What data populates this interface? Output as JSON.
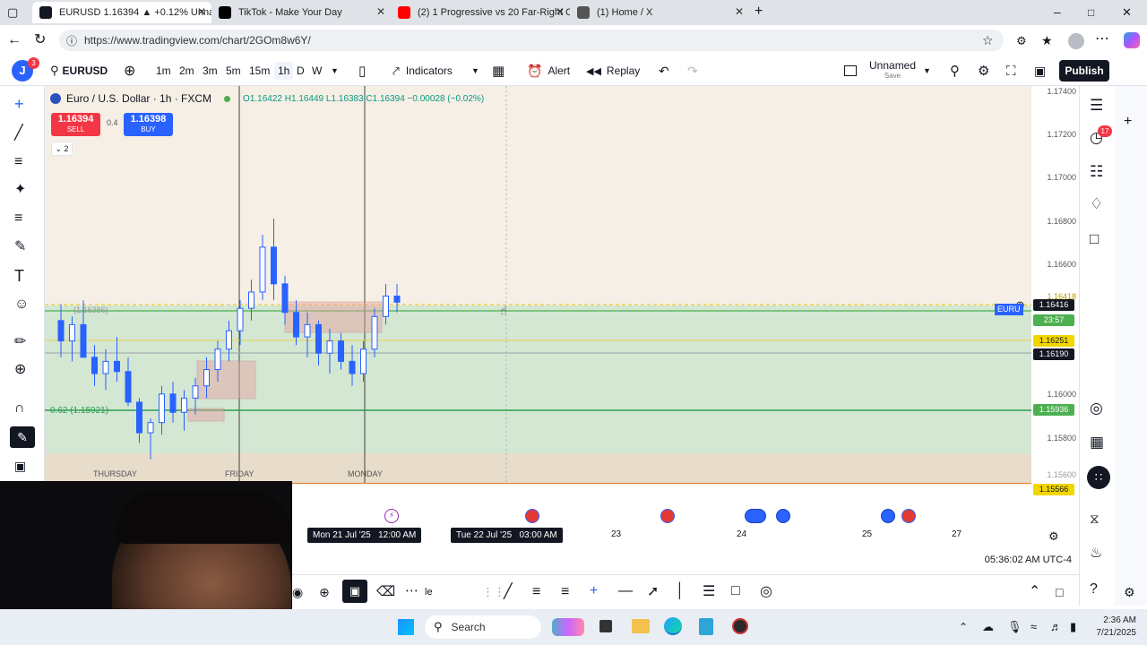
{
  "browser": {
    "tabs": [
      {
        "title": "EURUSD 1.16394 ▲ +0.12% Unna",
        "color": "#131722",
        "active": true
      },
      {
        "title": "TikTok - Make Your Day",
        "color": "#000000",
        "active": false
      },
      {
        "title": "(2) 1 Progressive vs 20 Far-Right C",
        "color": "#ff0000",
        "active": false
      },
      {
        "title": "(1) Home / X",
        "color": "#000000",
        "active": false
      }
    ],
    "url": "https://www.tradingview.com/chart/2GOm8w6Y/"
  },
  "header": {
    "avatar_letter": "J",
    "avatar_badge": "3",
    "symbol": "EURUSD",
    "intervals": [
      "1m",
      "2m",
      "3m",
      "5m",
      "15m",
      "1h",
      "D",
      "W"
    ],
    "active_interval": "1h",
    "indicators_label": "Indicators",
    "alert_label": "Alert",
    "replay_label": "Replay",
    "layout_name": "Unnamed",
    "layout_sub": "Save",
    "publish_label": "Publish"
  },
  "legend": {
    "title": "Euro / U.S. Dollar · 1h · FXCM",
    "ohlc": "O1.16422 H1.16449 L1.16383 C1.16394 −0.00028 (−0.02%)",
    "sell_price": "1.16394",
    "sell_label": "SELL",
    "spread": "0.4",
    "buy_price": "1.16398",
    "buy_label": "BUY",
    "collapse_count": "2"
  },
  "chart": {
    "fib_label_upper": "(1.16386)",
    "fib_label_lower": "0.62 (1.15921)",
    "day_labels": [
      "THURSDAY",
      "FRIDAY",
      "MONDAY"
    ],
    "symbol_tag": "EURU"
  },
  "price_axis": {
    "labels": [
      "1.17400",
      "1.17200",
      "1.17000",
      "1.16800",
      "1.16600",
      "1.16000",
      "1.15800",
      "1.15600"
    ],
    "badges": [
      {
        "text": "1.16416",
        "color": "#131722"
      },
      {
        "text": "23:57",
        "color": "#4caf50"
      },
      {
        "text": "1.16251",
        "color": "#f2d600"
      },
      {
        "text": "1.16190",
        "color": "#131722"
      },
      {
        "text": "1.15936",
        "color": "#4caf50"
      },
      {
        "text": "1.15566",
        "color": "#f2d600"
      }
    ],
    "partial": "1.16418"
  },
  "time_axis": {
    "cursor_left": "Mon 21 Jul '25",
    "cursor_left_time": "12:00 AM",
    "cursor_right": "Tue 22 Jul '25",
    "cursor_right_time": "03:00 AM",
    "days": [
      "23",
      "24",
      "25",
      "27"
    ],
    "clock": "05:36:02 AM UTC-4"
  },
  "right_toolbar": {
    "alerts_badge": "17"
  },
  "taskbar": {
    "search": "Search",
    "time": "2:36 AM",
    "date": "7/21/2025"
  },
  "partial_text": "le",
  "chart_data": {
    "type": "candlestick",
    "title": "Euro / U.S. Dollar · 1h · FXCM",
    "ylim": [
      1.155,
      1.1745
    ],
    "day_separators": [
      "FRIDAY",
      "MONDAY"
    ],
    "candles": [
      [
        1.163,
        1.1638,
        1.1612,
        1.162
      ],
      [
        1.162,
        1.1632,
        1.161,
        1.1628
      ],
      [
        1.1628,
        1.164,
        1.1622,
        1.1612
      ],
      [
        1.1612,
        1.1618,
        1.1598,
        1.1604
      ],
      [
        1.1604,
        1.1616,
        1.1596,
        1.161
      ],
      [
        1.161,
        1.1622,
        1.16,
        1.1605
      ],
      [
        1.1605,
        1.1612,
        1.1588,
        1.159
      ],
      [
        1.159,
        1.1592,
        1.157,
        1.1575
      ],
      [
        1.1575,
        1.1582,
        1.1562,
        1.158
      ],
      [
        1.158,
        1.1598,
        1.1574,
        1.1594
      ],
      [
        1.1594,
        1.16,
        1.158,
        1.1585
      ],
      [
        1.1585,
        1.1596,
        1.1576,
        1.1592
      ],
      [
        1.1592,
        1.1602,
        1.1584,
        1.1598
      ],
      [
        1.1598,
        1.1612,
        1.1592,
        1.1606
      ],
      [
        1.1606,
        1.162,
        1.16,
        1.1616
      ],
      [
        1.1616,
        1.163,
        1.161,
        1.1625
      ],
      [
        1.1625,
        1.164,
        1.1618,
        1.1636
      ],
      [
        1.1636,
        1.165,
        1.163,
        1.1644
      ],
      [
        1.1644,
        1.1672,
        1.164,
        1.1666
      ],
      [
        1.1666,
        1.168,
        1.164,
        1.1648
      ],
      [
        1.1648,
        1.1652,
        1.1628,
        1.1634
      ],
      [
        1.1634,
        1.164,
        1.1618,
        1.1622
      ],
      [
        1.1622,
        1.1634,
        1.1612,
        1.1628
      ],
      [
        1.1628,
        1.163,
        1.1608,
        1.1614
      ],
      [
        1.1614,
        1.1626,
        1.1604,
        1.162
      ],
      [
        1.162,
        1.1624,
        1.1606,
        1.161
      ],
      [
        1.161,
        1.1618,
        1.1598,
        1.1604
      ],
      [
        1.1604,
        1.162,
        1.16,
        1.1616
      ],
      [
        1.1616,
        1.1636,
        1.1612,
        1.1632
      ],
      [
        1.1632,
        1.1648,
        1.1628,
        1.1642
      ],
      [
        1.1642,
        1.1648,
        1.1634,
        1.1639
      ]
    ]
  }
}
